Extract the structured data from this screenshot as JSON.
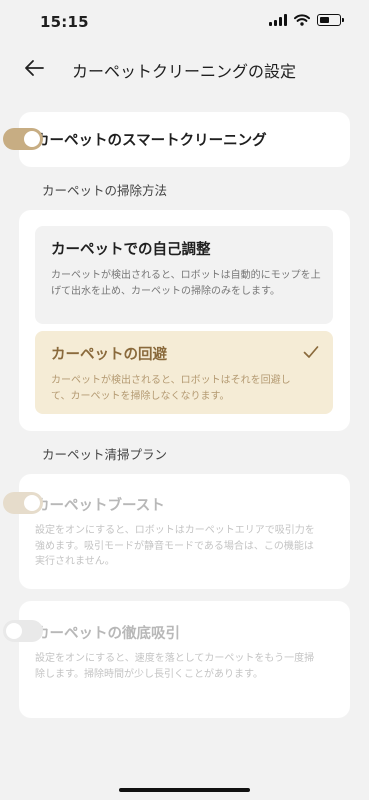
{
  "status": {
    "time": "15:15"
  },
  "header": {
    "title": "カーペットクリーニングの設定"
  },
  "smart_cleaning": {
    "label": "カーペットのスマートクリーニング",
    "enabled": true
  },
  "method_section": {
    "label": "カーペットの掃除方法",
    "options": [
      {
        "title": "カーペットでの自己調整",
        "desc": "カーペットが検出されると、ロボットは自動的にモップを上げて出水を止め、カーペットの掃除のみをします。",
        "selected": false
      },
      {
        "title": "カーペットの回避",
        "desc": "カーペットが検出されると、ロボットはそれを回避して、カーペットを掃除しなくなります。",
        "selected": true
      }
    ]
  },
  "plan_section": {
    "label": "カーペット清掃プラン",
    "boost": {
      "title": "カーペットブースト",
      "desc": "設定をオンにすると、ロボットはカーペットエリアで吸引力を強めます。吸引モードが静音モードである場合は、この機能は実行されません。",
      "enabled": true
    },
    "deep": {
      "title": "カーペットの徹底吸引",
      "desc": "設定をオンにすると、速度を落としてカーペットをもう一度掃除します。掃除時間が少し長引くことがあります。",
      "enabled": false
    }
  },
  "colors": {
    "accent": "#c7ad83",
    "accent_disabled": "#e6dccb",
    "selected_bg": "#f5ecd6",
    "selected_text": "#8a6a3c",
    "toggle_off": "#e9e9e9"
  }
}
